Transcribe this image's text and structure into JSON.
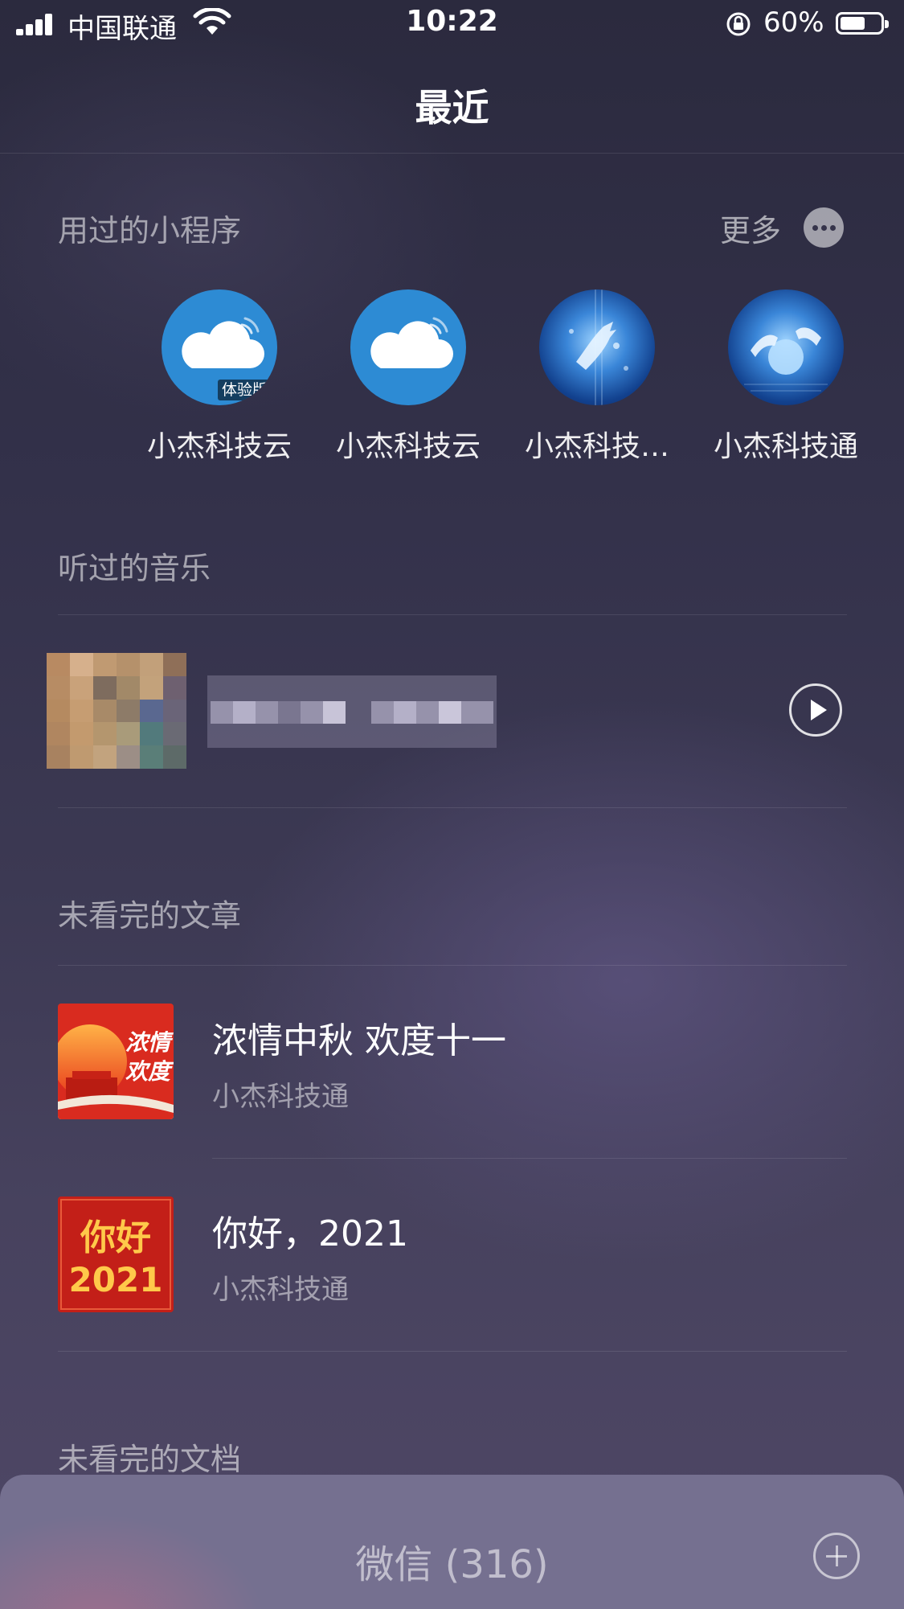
{
  "status_bar": {
    "carrier": "中国联通",
    "time": "10:22",
    "battery": "60%",
    "battery_level": 0.6
  },
  "page": {
    "title": "最近"
  },
  "mini_programs": {
    "label": "用过的小程序",
    "more": "更多",
    "items": [
      {
        "name": "小杰科技云",
        "icon": "cloud-icon",
        "badge": "体验版"
      },
      {
        "name": "小杰科技云",
        "icon": "cloud-icon"
      },
      {
        "name": "小杰科技…",
        "icon": "tech-hand-icon"
      },
      {
        "name": "小杰科技通",
        "icon": "tech-hand-icon"
      }
    ]
  },
  "music": {
    "label": "听过的音乐"
  },
  "articles": {
    "label": "未看完的文章",
    "items": [
      {
        "title": "浓情中秋 欢度十一",
        "source": "小杰科技通",
        "thumb_text": "浓情欢度"
      },
      {
        "title": "你好，2021",
        "source": "小杰科技通",
        "thumb_text": "你好2021"
      }
    ]
  },
  "documents": {
    "label": "未看完的文档"
  },
  "bottom": {
    "label": "微信 (316)"
  },
  "colors": {
    "background": "#33314a",
    "accent_cloud": "#2d8bd4",
    "article_red": "#d92b1f"
  }
}
